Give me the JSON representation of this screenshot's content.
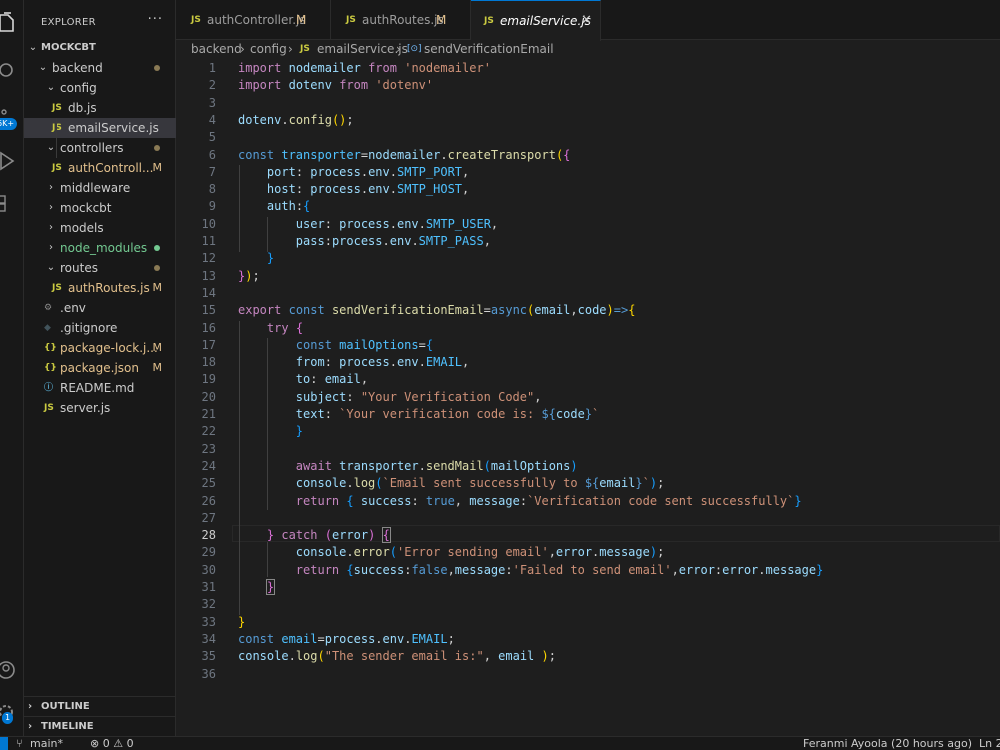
{
  "explorer": {
    "title": "EXPLORER",
    "more": "···",
    "root": "MOCKCBT",
    "items": [
      {
        "label": "backend",
        "kind": "folder",
        "open": true,
        "status": "dot",
        "depth": 1
      },
      {
        "label": "config",
        "kind": "folder",
        "open": true,
        "status": "",
        "depth": 2
      },
      {
        "label": "db.js",
        "kind": "js",
        "status": "",
        "depth": 3
      },
      {
        "label": "emailService.js",
        "kind": "js",
        "status": "",
        "depth": 3,
        "selected": true
      },
      {
        "label": "controllers",
        "kind": "folder",
        "open": true,
        "status": "dot",
        "depth": 2
      },
      {
        "label": "authControll...",
        "kind": "js",
        "status": "M",
        "depth": 3
      },
      {
        "label": "middleware",
        "kind": "folder",
        "open": false,
        "status": "",
        "depth": 2
      },
      {
        "label": "mockcbt",
        "kind": "folder",
        "open": false,
        "status": "",
        "depth": 2
      },
      {
        "label": "models",
        "kind": "folder",
        "open": false,
        "status": "",
        "depth": 2
      },
      {
        "label": "node_modules",
        "kind": "folder",
        "open": false,
        "status": "greendot",
        "depth": 2
      },
      {
        "label": "routes",
        "kind": "folder",
        "open": true,
        "status": "dot",
        "depth": 2
      },
      {
        "label": "authRoutes.js",
        "kind": "js",
        "status": "M",
        "depth": 3
      },
      {
        "label": ".env",
        "kind": "env",
        "status": "",
        "depth": 2
      },
      {
        "label": ".gitignore",
        "kind": "git",
        "status": "",
        "depth": 2
      },
      {
        "label": "package-lock.j...",
        "kind": "json",
        "status": "M",
        "depth": 2
      },
      {
        "label": "package.json",
        "kind": "json",
        "status": "M",
        "depth": 2
      },
      {
        "label": "README.md",
        "kind": "info",
        "status": "",
        "depth": 2
      },
      {
        "label": "server.js",
        "kind": "js",
        "status": "",
        "depth": 2
      }
    ],
    "outline": "OUTLINE",
    "timeline": "TIMELINE"
  },
  "icons": {
    "js": "JS",
    "json": "{}",
    "info": "ⓘ",
    "env": "⚙",
    "git": "◆",
    "chev_open": "⌄",
    "chev_closed": "›"
  },
  "activity": {
    "accounts_badge": "1",
    "ext_badge": "6K+"
  },
  "tabs": [
    {
      "label": "authController.js",
      "status": "M",
      "active": false
    },
    {
      "label": "authRoutes.js",
      "status": "M",
      "active": false
    },
    {
      "label": "emailService.js",
      "status": "",
      "active": true,
      "close": "✕"
    }
  ],
  "breadcrumb": {
    "parts": [
      "backend",
      "config",
      "emailService.js",
      "sendVerificationEmail"
    ],
    "sep": "›",
    "js": "JS",
    "sym": "[⊙]"
  },
  "editor": {
    "current_line": 28,
    "lines": [
      [
        [
          "k",
          "import"
        ],
        [
          "p",
          " "
        ],
        [
          "v",
          "nodemailer"
        ],
        [
          "p",
          " "
        ],
        [
          "k",
          "from"
        ],
        [
          "p",
          " "
        ],
        [
          "s",
          "'nodemailer'"
        ]
      ],
      [
        [
          "k",
          "import"
        ],
        [
          "p",
          " "
        ],
        [
          "v",
          "dotenv"
        ],
        [
          "p",
          " "
        ],
        [
          "k",
          "from"
        ],
        [
          "p",
          " "
        ],
        [
          "s",
          "'dotenv'"
        ]
      ],
      [],
      [
        [
          "v",
          "dotenv"
        ],
        [
          "p",
          "."
        ],
        [
          "f",
          "config"
        ],
        [
          "br1",
          "()"
        ],
        [
          "p",
          ";"
        ]
      ],
      [],
      [
        [
          "b",
          "const"
        ],
        [
          "p",
          " "
        ],
        [
          "c",
          "transporter"
        ],
        [
          "p",
          "="
        ],
        [
          "v",
          "nodemailer"
        ],
        [
          "p",
          "."
        ],
        [
          "f",
          "createTransport"
        ],
        [
          "br1",
          "("
        ],
        [
          "br2",
          "{"
        ]
      ],
      [
        [
          "p",
          "    "
        ],
        [
          "v",
          "port"
        ],
        [
          "p",
          ": "
        ],
        [
          "v",
          "process"
        ],
        [
          "p",
          "."
        ],
        [
          "v",
          "env"
        ],
        [
          "p",
          "."
        ],
        [
          "c",
          "SMTP_PORT"
        ],
        [
          "p",
          ","
        ]
      ],
      [
        [
          "p",
          "    "
        ],
        [
          "v",
          "host"
        ],
        [
          "p",
          ": "
        ],
        [
          "v",
          "process"
        ],
        [
          "p",
          "."
        ],
        [
          "v",
          "env"
        ],
        [
          "p",
          "."
        ],
        [
          "c",
          "SMTP_HOST"
        ],
        [
          "p",
          ","
        ]
      ],
      [
        [
          "p",
          "    "
        ],
        [
          "v",
          "auth"
        ],
        [
          "p",
          ":"
        ],
        [
          "br3",
          "{"
        ]
      ],
      [
        [
          "p",
          "        "
        ],
        [
          "v",
          "user"
        ],
        [
          "p",
          ": "
        ],
        [
          "v",
          "process"
        ],
        [
          "p",
          "."
        ],
        [
          "v",
          "env"
        ],
        [
          "p",
          "."
        ],
        [
          "c",
          "SMTP_USER"
        ],
        [
          "p",
          ","
        ]
      ],
      [
        [
          "p",
          "        "
        ],
        [
          "v",
          "pass"
        ],
        [
          "p",
          ":"
        ],
        [
          "v",
          "process"
        ],
        [
          "p",
          "."
        ],
        [
          "v",
          "env"
        ],
        [
          "p",
          "."
        ],
        [
          "c",
          "SMTP_PASS"
        ],
        [
          "p",
          ","
        ]
      ],
      [
        [
          "p",
          "    "
        ],
        [
          "br3",
          "}"
        ]
      ],
      [
        [
          "br2",
          "}"
        ],
        [
          "br1",
          ")"
        ],
        [
          "p",
          ";"
        ]
      ],
      [],
      [
        [
          "k",
          "export"
        ],
        [
          "p",
          " "
        ],
        [
          "b",
          "const"
        ],
        [
          "p",
          " "
        ],
        [
          "f",
          "sendVerificationEmail"
        ],
        [
          "p",
          "="
        ],
        [
          "b",
          "async"
        ],
        [
          "br1",
          "("
        ],
        [
          "v",
          "email"
        ],
        [
          "p",
          ","
        ],
        [
          "v",
          "code"
        ],
        [
          "br1",
          ")"
        ],
        [
          "b",
          "=>"
        ],
        [
          "br1",
          "{"
        ]
      ],
      [
        [
          "p",
          "    "
        ],
        [
          "k",
          "try"
        ],
        [
          "p",
          " "
        ],
        [
          "br2",
          "{"
        ]
      ],
      [
        [
          "p",
          "        "
        ],
        [
          "b",
          "const"
        ],
        [
          "p",
          " "
        ],
        [
          "c",
          "mailOptions"
        ],
        [
          "p",
          "="
        ],
        [
          "br3",
          "{"
        ]
      ],
      [
        [
          "p",
          "        "
        ],
        [
          "v",
          "from"
        ],
        [
          "p",
          ": "
        ],
        [
          "v",
          "process"
        ],
        [
          "p",
          "."
        ],
        [
          "v",
          "env"
        ],
        [
          "p",
          "."
        ],
        [
          "c",
          "EMAIL"
        ],
        [
          "p",
          ","
        ]
      ],
      [
        [
          "p",
          "        "
        ],
        [
          "v",
          "to"
        ],
        [
          "p",
          ": "
        ],
        [
          "v",
          "email"
        ],
        [
          "p",
          ","
        ]
      ],
      [
        [
          "p",
          "        "
        ],
        [
          "v",
          "subject"
        ],
        [
          "p",
          ": "
        ],
        [
          "s",
          "\"Your Verification Code\""
        ],
        [
          "p",
          ","
        ]
      ],
      [
        [
          "p",
          "        "
        ],
        [
          "v",
          "text"
        ],
        [
          "p",
          ": "
        ],
        [
          "s",
          "`Your verification code is: "
        ],
        [
          "b",
          "${"
        ],
        [
          "v",
          "code"
        ],
        [
          "b",
          "}"
        ],
        [
          "s",
          "`"
        ]
      ],
      [
        [
          "p",
          "        "
        ],
        [
          "br3",
          "}"
        ]
      ],
      [],
      [
        [
          "p",
          "        "
        ],
        [
          "k",
          "await"
        ],
        [
          "p",
          " "
        ],
        [
          "v",
          "transporter"
        ],
        [
          "p",
          "."
        ],
        [
          "f",
          "sendMail"
        ],
        [
          "br3",
          "("
        ],
        [
          "v",
          "mailOptions"
        ],
        [
          "br3",
          ")"
        ]
      ],
      [
        [
          "p",
          "        "
        ],
        [
          "v",
          "console"
        ],
        [
          "p",
          "."
        ],
        [
          "f",
          "log"
        ],
        [
          "br3",
          "("
        ],
        [
          "s",
          "`Email sent successfully to "
        ],
        [
          "b",
          "${"
        ],
        [
          "v",
          "email"
        ],
        [
          "b",
          "}"
        ],
        [
          "s",
          "`"
        ],
        [
          "br3",
          ")"
        ],
        [
          "p",
          ";"
        ]
      ],
      [
        [
          "p",
          "        "
        ],
        [
          "k",
          "return"
        ],
        [
          "p",
          " "
        ],
        [
          "br3",
          "{"
        ],
        [
          "p",
          " "
        ],
        [
          "v",
          "success"
        ],
        [
          "p",
          ": "
        ],
        [
          "b",
          "true"
        ],
        [
          "p",
          ", "
        ],
        [
          "v",
          "message"
        ],
        [
          "p",
          ":"
        ],
        [
          "s",
          "`Verification code sent successfully`"
        ],
        [
          "br3",
          "}"
        ]
      ],
      [],
      [
        [
          "p",
          "    "
        ],
        [
          "br2",
          "}"
        ],
        [
          "p",
          " "
        ],
        [
          "k",
          "catch"
        ],
        [
          "p",
          " "
        ],
        [
          "br2",
          "("
        ],
        [
          "v",
          "error"
        ],
        [
          "br2",
          ")"
        ],
        [
          "p",
          " "
        ],
        [
          "br2m",
          "{"
        ]
      ],
      [
        [
          "p",
          "        "
        ],
        [
          "v",
          "console"
        ],
        [
          "p",
          "."
        ],
        [
          "f",
          "error"
        ],
        [
          "br3",
          "("
        ],
        [
          "s",
          "'Error sending email'"
        ],
        [
          "p",
          ","
        ],
        [
          "v",
          "error"
        ],
        [
          "p",
          "."
        ],
        [
          "v",
          "message"
        ],
        [
          "br3",
          ")"
        ],
        [
          "p",
          ";"
        ]
      ],
      [
        [
          "p",
          "        "
        ],
        [
          "k",
          "return"
        ],
        [
          "p",
          " "
        ],
        [
          "br3",
          "{"
        ],
        [
          "v",
          "success"
        ],
        [
          "p",
          ":"
        ],
        [
          "b",
          "false"
        ],
        [
          "p",
          ","
        ],
        [
          "v",
          "message"
        ],
        [
          "p",
          ":"
        ],
        [
          "s",
          "'Failed to send email'"
        ],
        [
          "p",
          ","
        ],
        [
          "v",
          "error"
        ],
        [
          "p",
          ":"
        ],
        [
          "v",
          "error"
        ],
        [
          "p",
          "."
        ],
        [
          "v",
          "message"
        ],
        [
          "br3",
          "}"
        ]
      ],
      [
        [
          "p",
          "    "
        ],
        [
          "br2m",
          "}"
        ]
      ],
      [],
      [
        [
          "br1",
          "}"
        ]
      ],
      [
        [
          "b",
          "const"
        ],
        [
          "p",
          " "
        ],
        [
          "c",
          "email"
        ],
        [
          "p",
          "="
        ],
        [
          "v",
          "process"
        ],
        [
          "p",
          "."
        ],
        [
          "v",
          "env"
        ],
        [
          "p",
          "."
        ],
        [
          "c",
          "EMAIL"
        ],
        [
          "p",
          ";"
        ]
      ],
      [
        [
          "v",
          "console"
        ],
        [
          "p",
          "."
        ],
        [
          "f",
          "log"
        ],
        [
          "br1",
          "("
        ],
        [
          "s",
          "\"The sender email is:\""
        ],
        [
          "p",
          ", "
        ],
        [
          "v",
          "email"
        ],
        [
          "p",
          " "
        ],
        [
          "br1",
          ")"
        ],
        [
          "p",
          ";"
        ]
      ],
      []
    ]
  },
  "status": {
    "branch": "main*",
    "problems": "⊗ 0 ⚠ 0",
    "author": "Feranmi Ayoola (20 hours ago)",
    "position": "Ln 2"
  }
}
